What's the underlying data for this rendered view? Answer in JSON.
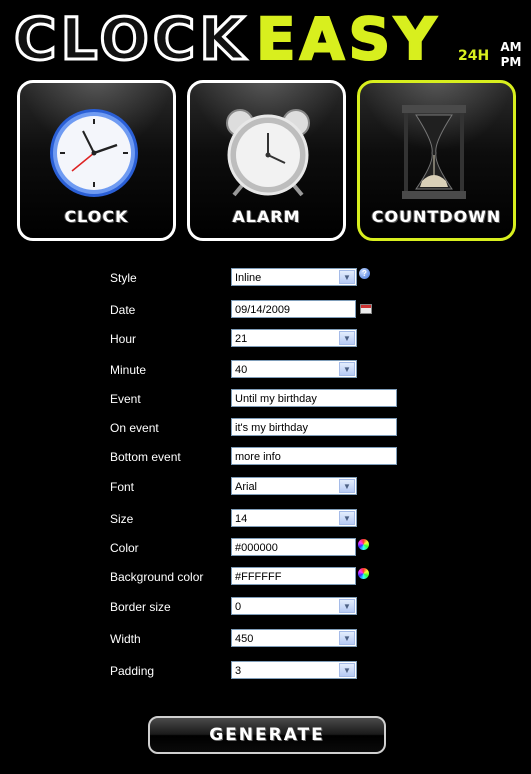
{
  "logo": {
    "part1": "CLOCK",
    "part2": "EASY"
  },
  "time_format": {
    "h24": "24H",
    "am": "AM",
    "pm": "PM"
  },
  "tiles": [
    {
      "label": "CLOCK",
      "icon": "wall-clock-icon"
    },
    {
      "label": "ALARM",
      "icon": "alarm-clock-icon"
    },
    {
      "label": "COUNTDOWN",
      "icon": "hourglass-icon",
      "active": true
    }
  ],
  "form": {
    "style": {
      "label": "Style",
      "value": "Inline"
    },
    "date": {
      "label": "Date",
      "value": "09/14/2009"
    },
    "hour": {
      "label": "Hour",
      "value": "21"
    },
    "minute": {
      "label": "Minute",
      "value": "40"
    },
    "event": {
      "label": "Event",
      "value": "Until my birthday"
    },
    "on_event": {
      "label": "On event",
      "value": "it's my birthday"
    },
    "bottom_event": {
      "label": "Bottom event",
      "value": "more info"
    },
    "font": {
      "label": "Font",
      "value": "Arial"
    },
    "size": {
      "label": "Size",
      "value": "14"
    },
    "color": {
      "label": "Color",
      "value": "#000000"
    },
    "background_color": {
      "label": "Background color",
      "value": "#FFFFFF"
    },
    "border_size": {
      "label": "Border size",
      "value": "0"
    },
    "width": {
      "label": "Width",
      "value": "450"
    },
    "padding": {
      "label": "Padding",
      "value": "3"
    }
  },
  "generate_label": "GENERATE",
  "colors": {
    "accent": "#d8ef1e",
    "background": "#000000",
    "tile_border": "#ffffff"
  }
}
